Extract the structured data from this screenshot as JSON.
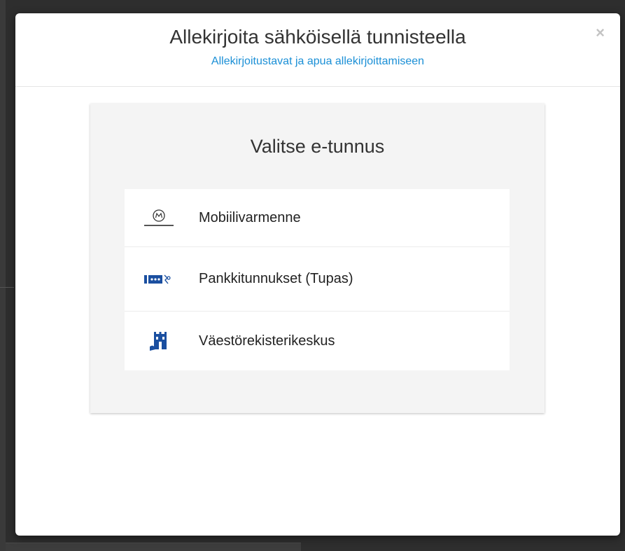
{
  "dialog": {
    "title": "Allekirjoita sähköisellä tunnisteella",
    "help_link": "Allekirjoitustavat ja apua allekirjoittamiseen",
    "close_label": "×"
  },
  "panel": {
    "title": "Valitse e-tunnus",
    "options": [
      {
        "label": "Mobiilivarmenne",
        "icon": "mobiilivarmenne-logo-icon"
      },
      {
        "label": "Pankkitunnukset (Tupas)",
        "icon": "tupas-logo-icon"
      },
      {
        "label": "Väestörekisterikeskus",
        "icon": "vrk-logo-icon"
      }
    ]
  },
  "colors": {
    "link": "#1a8fd6",
    "logo_blue": "#1a4fa0"
  }
}
